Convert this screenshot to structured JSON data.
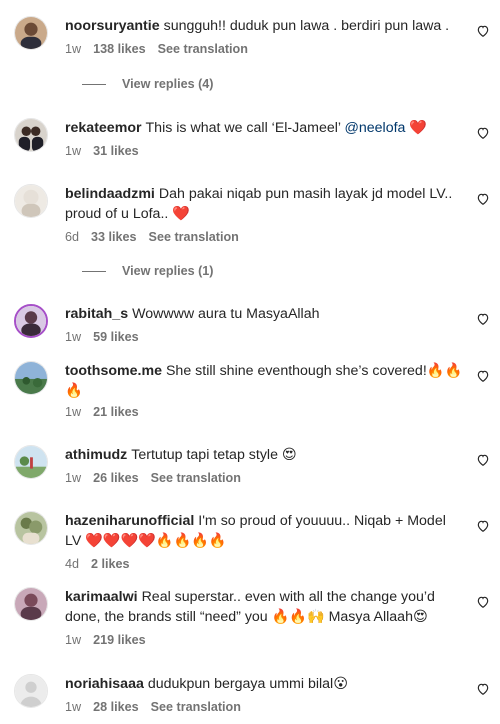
{
  "comments": [
    {
      "username": "noorsuryantie",
      "text": "sungguh!! duduk pun lawa . berdiri pun lawa .",
      "time": "1w",
      "likes": "138 likes",
      "translate": "See translation",
      "avatar_color": "#b07a55"
    },
    {
      "username": "rekateemor",
      "text": "This is what we call ‘El-Jameel’",
      "mention": "@neelofa",
      "emoji": "❤️",
      "time": "1w",
      "likes": "31 likes",
      "avatar_color": "#3a3a44"
    },
    {
      "username": "belindaadzmi",
      "text": "Dah pakai niqab pun masih layak jd model LV.. proud of u Lofa..",
      "emoji": "❤️",
      "time": "6d",
      "likes": "33 likes",
      "translate": "See translation",
      "avatar_color": "#d9cfc4"
    },
    {
      "username": "rabitah_s",
      "text": "Wowwww aura tu MasyaAllah",
      "time": "1w",
      "likes": "59 likes",
      "avatar_color": "#8e5aa8"
    },
    {
      "username": "toothsome.me",
      "text": "She still shine eventhough she’s covered!",
      "emoji": "🔥🔥🔥",
      "time": "1w",
      "likes": "21 likes",
      "avatar_color": "#4a7a4a"
    },
    {
      "username": "athimudz",
      "text": "Tertutup tapi tetap style",
      "emoji": "😍",
      "time": "1w",
      "likes": "26 likes",
      "translate": "See translation",
      "avatar_color": "#7fa86a"
    },
    {
      "username": "hazeniharunofficial",
      "text": "I'm so proud of youuuu.. Niqab + Model LV",
      "emoji": "❤️❤️❤️❤️🔥🔥🔥🔥",
      "time": "4d",
      "likes": "2 likes",
      "avatar_color": "#8a9a6a"
    },
    {
      "username": "karimaalwi",
      "text": "Real superstar.. even with all the change you’d done, the brands still “need” you 🔥🔥🙌 Masya Allaah😍",
      "time": "1w",
      "likes": "219 likes",
      "avatar_color": "#9a6a7a"
    },
    {
      "username": "noriahisaaa",
      "text": "dudukpun bergaya ummi bilal",
      "emoji": "😮",
      "time": "1w",
      "likes": "28 likes",
      "translate": "See translation",
      "avatar_color": "#dbdbdb"
    }
  ],
  "view_replies": [
    {
      "label": "View replies (4)"
    },
    {
      "label": "View replies (1)"
    }
  ],
  "icons": {
    "like": "heart-outline-icon",
    "default_avatar": "default-avatar-icon"
  }
}
